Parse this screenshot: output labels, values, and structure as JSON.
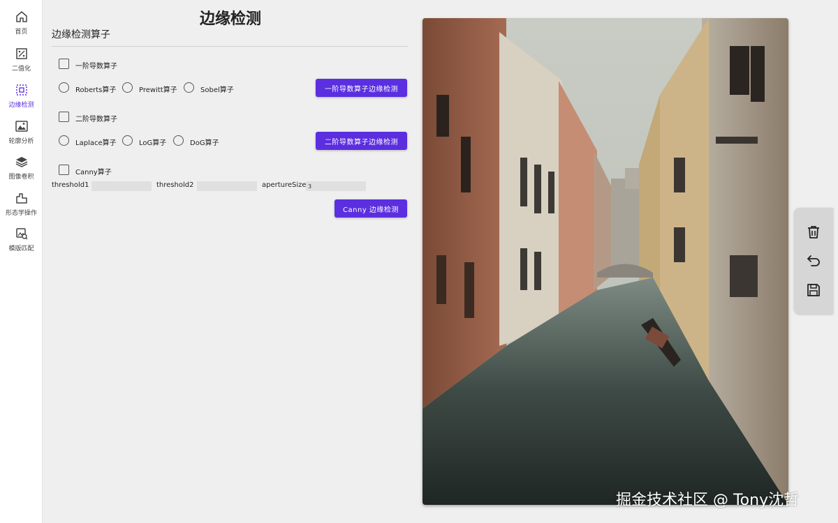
{
  "sidebar": {
    "items": [
      {
        "label": "首页",
        "icon": "home-icon"
      },
      {
        "label": "二值化",
        "icon": "threshold-icon"
      },
      {
        "label": "边缘检测",
        "icon": "edge-detect-icon",
        "active": true
      },
      {
        "label": "轮廓分析",
        "icon": "contour-icon"
      },
      {
        "label": "图像卷积",
        "icon": "layers-icon"
      },
      {
        "label": "形态学操作",
        "icon": "morphology-icon"
      },
      {
        "label": "模版匹配",
        "icon": "template-match-icon"
      }
    ]
  },
  "main": {
    "title": "边缘检测",
    "section_title": "边缘检测算子",
    "first_order": {
      "checkbox_label": "一阶导数算子",
      "options": [
        "Roberts算子",
        "Prewitt算子",
        "Sobel算子"
      ],
      "button_label": "一阶导数算子边缘检测"
    },
    "second_order": {
      "checkbox_label": "二阶导数算子",
      "options": [
        "Laplace算子",
        "LoG算子",
        "DoG算子"
      ],
      "button_label": "二阶导数算子边缘检测"
    },
    "canny": {
      "checkbox_label": "Canny算子",
      "threshold1_label": "threshold1",
      "threshold1_value": "",
      "threshold2_label": "threshold2",
      "threshold2_value": "",
      "aperture_label": "apertureSize",
      "aperture_value": "3",
      "button_label": "Canny 边缘检测"
    }
  },
  "image_panel": {
    "watermark": "掘金技术社区 @ Tony沈哲"
  },
  "toolbar": {
    "icons": [
      "trash-icon",
      "undo-icon",
      "save-icon"
    ]
  },
  "colors": {
    "accent": "#5b2ee0",
    "background": "#efefef",
    "sidebar": "#ffffff",
    "toolbar": "#d6d6d6"
  }
}
